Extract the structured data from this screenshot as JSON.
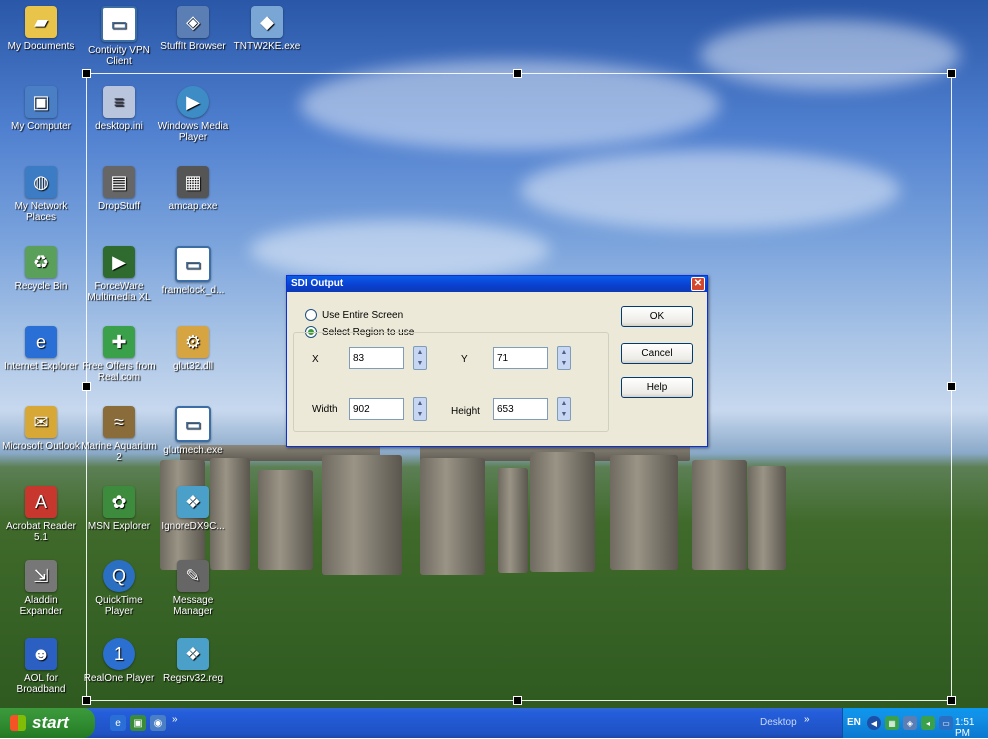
{
  "colors": {
    "titlebar": "#0a3fcf",
    "dialog_bg": "#ece9d8",
    "taskbar": "#245edb",
    "start": "#2f8a2f",
    "tray": "#0c97ee"
  },
  "desktop_icons": [
    {
      "label": "My Documents",
      "icon": "folder-icon",
      "color": "#e8c44a"
    },
    {
      "label": "Contivity VPN Client",
      "icon": "window-shortcut-icon",
      "color": "#3a6ea5"
    },
    {
      "label": "StuffIt Browser",
      "icon": "stuffit-browser-icon",
      "color": "#5b7fb5"
    },
    {
      "label": "TNTW2KE.exe",
      "icon": "exe-icon",
      "color": "#7aa6d6"
    },
    {
      "label": "My Computer",
      "icon": "computer-icon",
      "color": "#4a7fc6"
    },
    {
      "label": "desktop.ini",
      "icon": "ini-file-icon",
      "color": "#b8c5dd"
    },
    {
      "label": "Windows Media Player",
      "icon": "media-player-icon",
      "color": "#3d8cc6"
    },
    {
      "label": "My Network Places",
      "icon": "network-icon",
      "color": "#3b7cc5"
    },
    {
      "label": "DropStuff",
      "icon": "dropstuff-icon",
      "color": "#666"
    },
    {
      "label": "amcap.exe",
      "icon": "amcap-icon",
      "color": "#555"
    },
    {
      "label": "Recycle Bin",
      "icon": "recycle-bin-icon",
      "color": "#5aa05a"
    },
    {
      "label": "ForceWare Multimedia XL",
      "icon": "forceware-icon",
      "color": "#2f6b2f"
    },
    {
      "label": "framelock_d...",
      "icon": "window-icon",
      "color": "#3a6ea5"
    },
    {
      "label": "Internet Explorer",
      "icon": "ie-icon",
      "color": "#2a6fd6"
    },
    {
      "label": "Free Offers from Real.com",
      "icon": "gift-icon",
      "color": "#3aa04a"
    },
    {
      "label": "glut32.dll",
      "icon": "dll-icon",
      "color": "#d6a440"
    },
    {
      "label": "Microsoft Outlook",
      "icon": "outlook-icon",
      "color": "#d8a836"
    },
    {
      "label": "Marine Aquarium 2",
      "icon": "aquarium-icon",
      "color": "#8a6b3a"
    },
    {
      "label": "glutmech.exe",
      "icon": "window-icon",
      "color": "#3a6ea5"
    },
    {
      "label": "Acrobat Reader 5.1",
      "icon": "acrobat-icon",
      "color": "#c8372d"
    },
    {
      "label": "MSN Explorer",
      "icon": "msn-icon",
      "color": "#3d8c3d"
    },
    {
      "label": "IgnoreDX9C...",
      "icon": "cubes-icon",
      "color": "#4aa0c8"
    },
    {
      "label": "Aladdin Expander",
      "icon": "aladdin-icon",
      "color": "#777"
    },
    {
      "label": "QuickTime Player",
      "icon": "quicktime-icon",
      "color": "#2b6fc2"
    },
    {
      "label": "Message Manager",
      "icon": "message-manager-icon",
      "color": "#666"
    },
    {
      "label": "AOL for Broadband",
      "icon": "aol-icon",
      "color": "#2b5fc2"
    },
    {
      "label": "RealOne Player",
      "icon": "realone-icon",
      "color": "#2b6fd0"
    },
    {
      "label": "Regsrv32.reg",
      "icon": "cubes-icon",
      "color": "#4aa0c8"
    }
  ],
  "dialog": {
    "title": "SDI Output",
    "close_glyph": "✕",
    "radio_entire": "Use Entire Screen",
    "radio_region": "Select Region to use",
    "x_label": "X",
    "x_value": "83",
    "y_label": "Y",
    "y_value": "71",
    "width_label": "Width",
    "width_value": "902",
    "height_label": "Height",
    "height_value": "653",
    "ok": "OK",
    "cancel": "Cancel",
    "help": "Help"
  },
  "taskbar": {
    "start_label": "start",
    "quicklaunch_more": "»",
    "desktop_label": "Desktop",
    "tray_more": "»",
    "lang": "EN",
    "clock": "1:51 PM"
  }
}
